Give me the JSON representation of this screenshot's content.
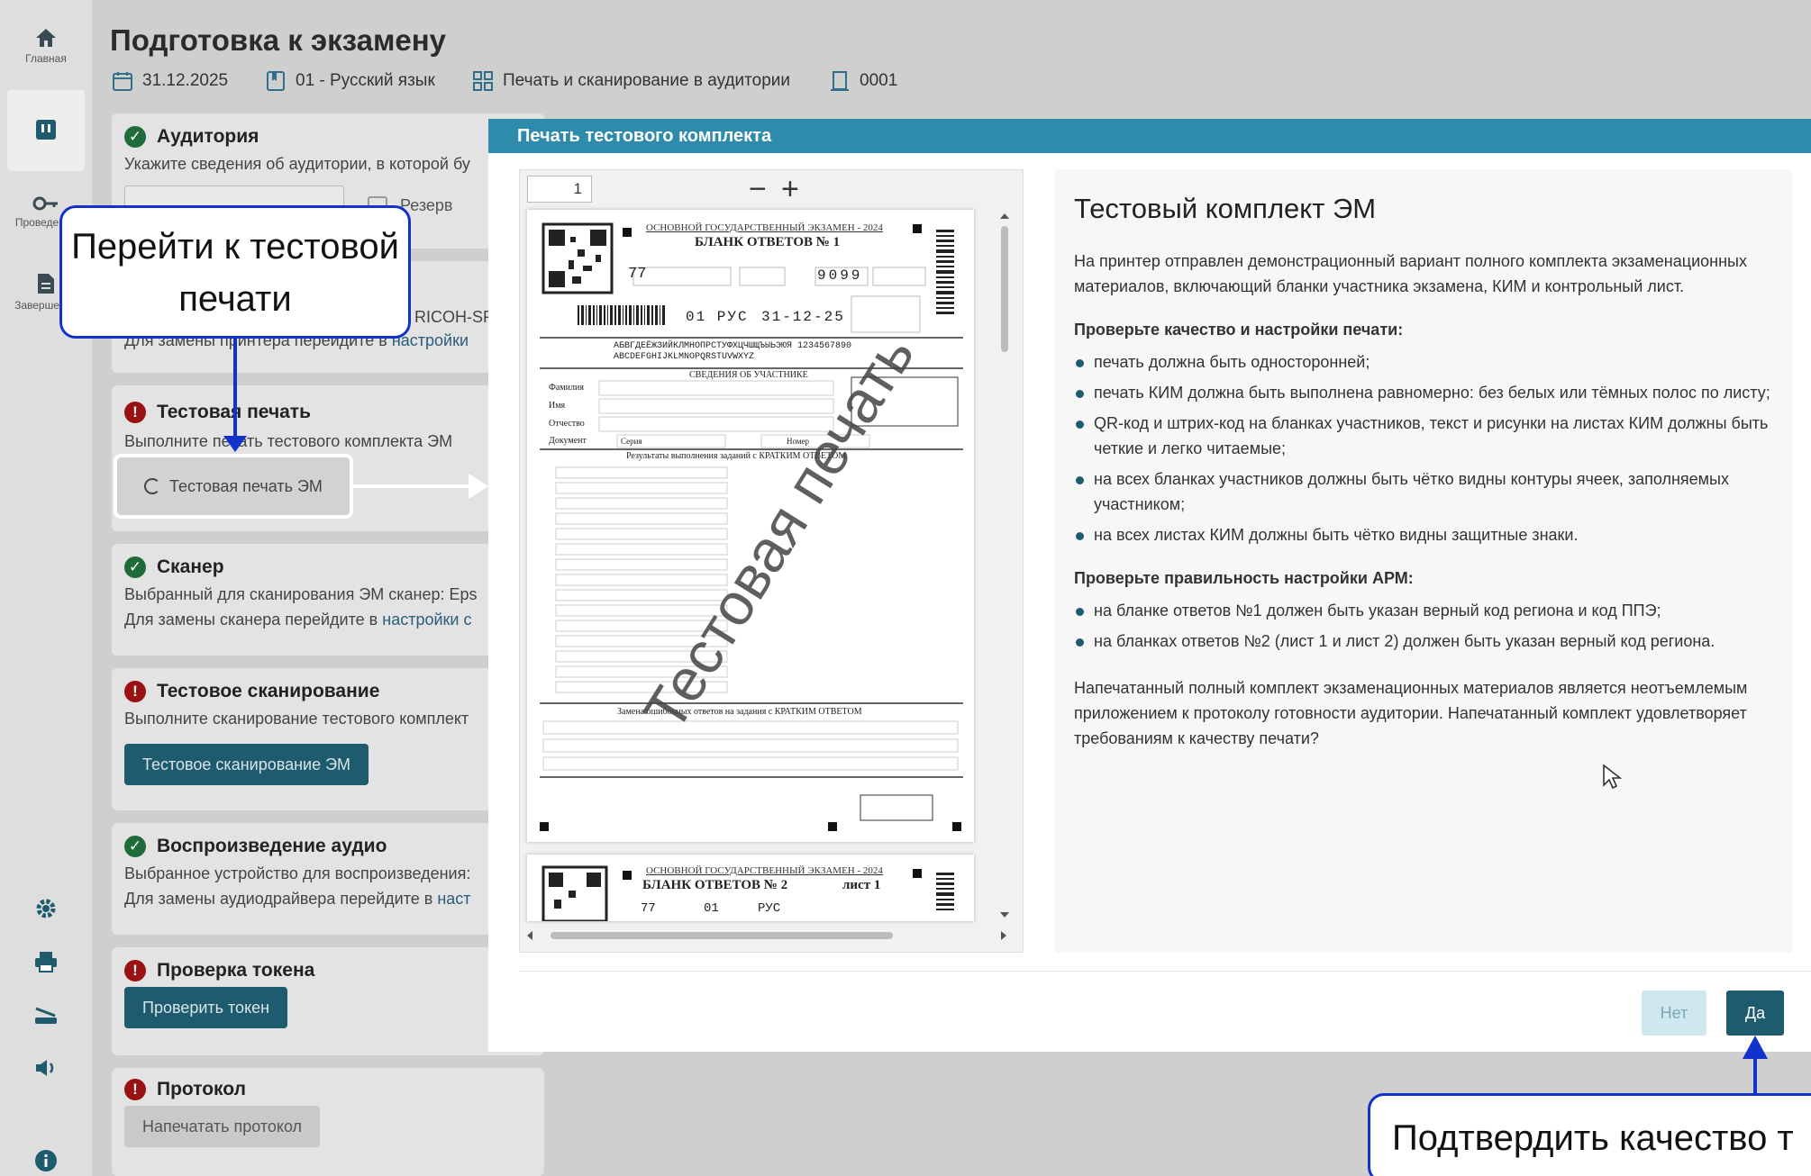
{
  "sidebar": {
    "items": [
      {
        "label": "Главная",
        "icon": "home-icon"
      },
      {
        "label": "",
        "icon": "exam-icon"
      },
      {
        "label": "Проведение",
        "icon": "key-icon"
      },
      {
        "label": "Завершение",
        "icon": "document-icon"
      }
    ],
    "bottom_icons": [
      "gear-icon",
      "printer-icon",
      "scanner-icon",
      "speaker-icon",
      "info-icon"
    ]
  },
  "header": {
    "title": "Подготовка к экзамену",
    "date": "31.12.2025",
    "subject": "01 - Русский язык",
    "mode": "Печать и сканирование в аудитории",
    "room": "0001"
  },
  "steps": {
    "auditorium": {
      "title": "Аудитория",
      "desc": "Укажите сведения об аудитории, в которой бу",
      "reserve_label": "Резерв"
    },
    "printer": {
      "model": "RICOH-SP",
      "desc_prefix": "Для замены принтера перейдите в",
      "link": "настройки"
    },
    "test_print": {
      "title": "Тестовая печать",
      "desc": "Выполните печать тестового комплекта ЭМ",
      "button": "Тестовая печать ЭМ"
    },
    "scanner": {
      "title": "Сканер",
      "desc1": "Выбранный для сканирования ЭМ сканер: Eps",
      "desc2_prefix": "Для замены сканера перейдите в",
      "link": "настройки с"
    },
    "test_scan": {
      "title": "Тестовое сканирование",
      "desc": "Выполните сканирование тестового комплект",
      "button": "Тестовое сканирование ЭМ"
    },
    "audio": {
      "title": "Воспроизведение аудио",
      "desc1": "Выбранное устройство для воспроизведения:",
      "desc2_prefix": "Для замены аудиодрайвера перейдите в",
      "link": "наст"
    },
    "token": {
      "title": "Проверка токена",
      "button": "Проверить токен"
    },
    "protocol": {
      "title": "Протокол",
      "button": "Напечатать протокол"
    }
  },
  "modal": {
    "title": "Печать тестового комплекта",
    "page_number": "1",
    "zoom_out": "−",
    "zoom_in": "+",
    "sheet1": {
      "header": "ОСНОВНОЙ ГОСУДАРСТВЕННЫЙ ЭКЗАМЕН - 2024",
      "title": "БЛАНК ОТВЕТОВ № 1",
      "region": "77",
      "code1": "9099",
      "row2": "01 РУС",
      "variant": "31-12-25",
      "alphabet1": "АБВГДЕЁЖЗИЙКЛМНОПРСТУФХЦЧШЩЪЫЬЭЮЯ 1234567890",
      "alphabet2": "ABCDEFGHIJKLMNOPQRSTUVWXYZ",
      "participant": "СВЕДЕНИЯ ОБ УЧАСТНИКЕ",
      "fields": [
        "Фамилия",
        "Имя",
        "Отчество",
        "Документ"
      ],
      "series": "Серия",
      "number": "Номер",
      "results": "Результаты выполнения заданий с КРАТКИМ ОТВЕТОМ",
      "replace": "Замена ошибочных ответов на задания с КРАТКИМ ОТВЕТОМ",
      "watermark": "Тестовая печать"
    },
    "sheet2": {
      "header": "ОСНОВНОЙ ГОСУДАРСТВЕННЫЙ ЭКЗАМЕН - 2024",
      "title": "БЛАНК ОТВЕТОВ № 2",
      "sheet": "лист 1",
      "region": "77",
      "code": "01",
      "subject": "РУС"
    },
    "info": {
      "heading": "Тестовый комплект ЭМ",
      "intro": "На принтер отправлен демонстрационный вариант полного комплекта экзаменационных материалов, включающий бланки участника экзамена, КИМ и контрольный лист.",
      "quality_heading": "Проверьте качество и настройки печати:",
      "quality_items": [
        "печать должна быть односторонней;",
        "печать КИМ должна быть выполнена равномерно: без белых или тёмных полос по листу;",
        "QR-код и штрих-код на бланках участников, текст и рисунки на листах КИМ должны быть четкие и легко читаемые;",
        "на всех бланках участников должны быть чётко видны контуры ячеек, заполняемых участником;",
        "на всех листах КИМ должны быть чётко видны защитные знаки."
      ],
      "arm_heading": "Проверьте правильность настройки АРМ:",
      "arm_items": [
        "на бланке ответов №1 должен быть указан верный код региона и код ППЭ;",
        "на бланках ответов №2 (лист 1 и лист 2) должен быть указан верный код региона."
      ],
      "final": "Напечатанный полный комплект экзаменационных материалов является неотъемлемым приложением к протоколу готовности аудитории. Напечатанный комплект удовлетворяет требованиям к качеству печати?"
    },
    "btn_no": "Нет",
    "btn_yes": "Да"
  },
  "callouts": {
    "go_to_test_print": "Перейти к тестовой печати",
    "confirm_quality": "Подтвердить качество т"
  },
  "colors": {
    "modal_header": "#2f8bab",
    "primary_button": "#1f5b6e",
    "callout_border": "#1133cc",
    "ok": "#1f6b3a",
    "error": "#9b1212"
  }
}
